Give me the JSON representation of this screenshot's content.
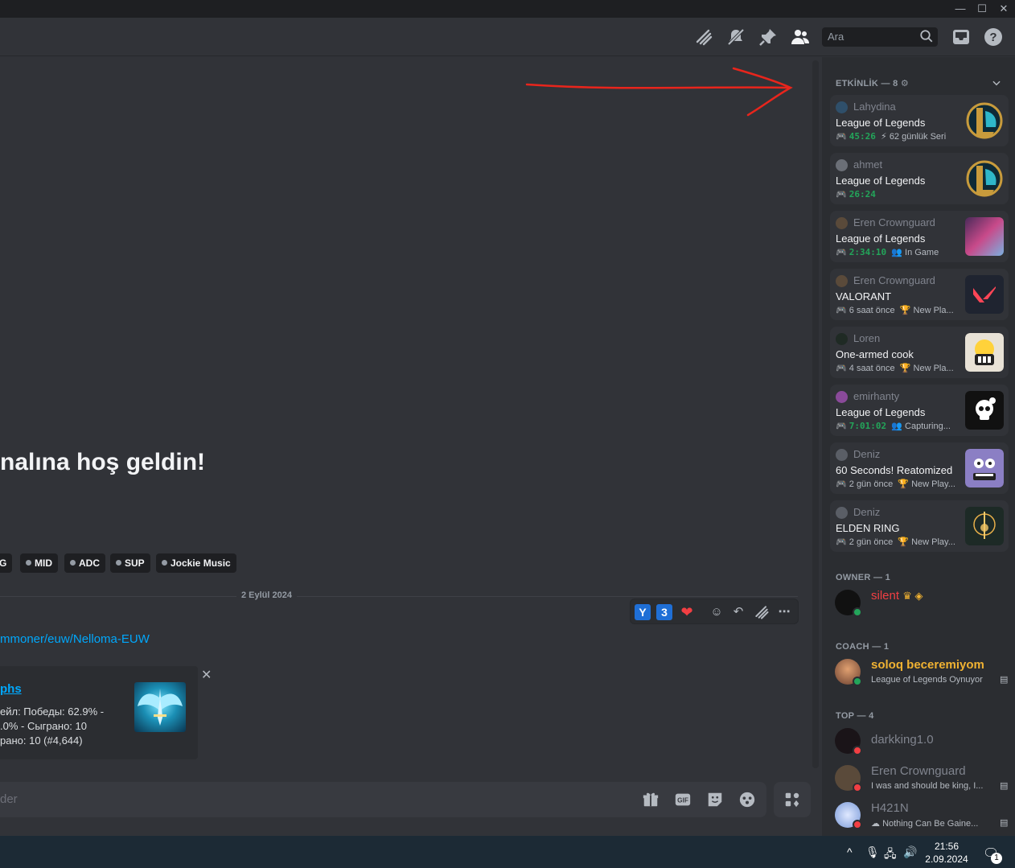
{
  "window": {
    "minimize": "—",
    "maximize": "☐",
    "close": "✕"
  },
  "header": {
    "search_placeholder": "Ara",
    "icons": [
      "threads-icon",
      "mute-bell-icon",
      "pin-icon",
      "members-icon",
      "inbox-icon",
      "help-icon"
    ]
  },
  "chat": {
    "welcome": "nalına hoş geldin!",
    "tags": [
      "G",
      "MID",
      "ADC",
      "SUP",
      "Jockie Music"
    ],
    "divider_date": "2 Eylül 2024",
    "reactions": {
      "y": "Y",
      "three": "3",
      "heart": "❤"
    },
    "link": "mmoner/euw/Nelloma-EUW",
    "embed": {
      "title": "phs",
      "lines": [
        "ейл: Победы: 62.9% -",
        ".0% - Сыграно: 10",
        "рано: 10 (#4,644)"
      ],
      "close": "✕"
    },
    "composer_placeholder": "der"
  },
  "sidebar": {
    "activity_title": "ETKİNLİK — 8",
    "activities": [
      {
        "user": "Lahydina",
        "game": "League of Legends",
        "time": "45:26",
        "extra": "62 günlük Seri",
        "extra_icon": "⚡",
        "avatar_color": "#2f4f6a",
        "thumb": "lol"
      },
      {
        "user": "ahmet",
        "game": "League of Legends",
        "time": "26:24",
        "extra": "",
        "extra_icon": "",
        "avatar_color": "#6b6f77",
        "thumb": "lol"
      },
      {
        "user": "Eren Crownguard",
        "game": "League of Legends",
        "time": "2:34:10",
        "extra": "In Game",
        "extra_icon": "👥",
        "avatar_color": "#5a4a3a",
        "thumb": "champ"
      },
      {
        "user": "Eren Crownguard",
        "game": "VALORANT",
        "time": "",
        "ago": "6 saat önce",
        "extra": "New Pla...",
        "extra_icon": "🏆",
        "avatar_color": "#5a4a3a",
        "thumb": "valorant"
      },
      {
        "user": "Loren",
        "game": "One-armed cook",
        "time": "",
        "ago": "4 saat önce",
        "extra": "New Pla...",
        "extra_icon": "🏆",
        "avatar_color": "#1f2a24",
        "thumb": "cook"
      },
      {
        "user": "emirhanty",
        "game": "League of Legends",
        "time": "7:01:02",
        "extra": "Capturing...",
        "extra_icon": "👥",
        "avatar_color": "#8a4a9a",
        "thumb": "skull"
      },
      {
        "user": "Deniz",
        "game": "60 Seconds! Reatomized",
        "time": "",
        "ago": "2 gün önce",
        "extra": "New Play...",
        "extra_icon": "🏆",
        "avatar_color": "#5a5e66",
        "thumb": "sixty"
      },
      {
        "user": "Deniz",
        "game": "ELDEN RING",
        "time": "",
        "ago": "2 gün önce",
        "extra": "New Play...",
        "extra_icon": "🏆",
        "avatar_color": "#5a5e66",
        "thumb": "elden"
      }
    ],
    "owner_title": "OWNER — 1",
    "owner": {
      "name": "silent",
      "badges": "♛ ◈"
    },
    "coach_title": "COACH — 1",
    "coach": {
      "name": "soloq beceremiyom",
      "sub": "League of Legends Oynuyor"
    },
    "top_title": "TOP — 4",
    "top": [
      {
        "name": "darkking1.0",
        "sub": ""
      },
      {
        "name": "Eren Crownguard",
        "sub": "I was and should be king, I..."
      },
      {
        "name": "H421N",
        "sub": "Nothing Can Be Gaine..."
      }
    ]
  },
  "taskbar": {
    "time": "21:56",
    "date": "2.09.2024",
    "notif_count": "1"
  },
  "colors": {
    "accent_link": "#00a8fc",
    "online": "#23a55a",
    "dnd": "#f23f43",
    "owner": "#f23f43",
    "coach": "#f0b232"
  }
}
